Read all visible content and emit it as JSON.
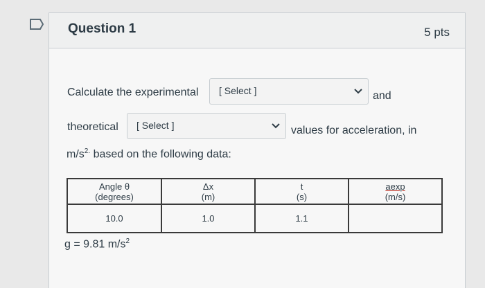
{
  "question": {
    "title": "Question 1",
    "points": "5 pts"
  },
  "prompt": {
    "line1_pre": "Calculate the experimental",
    "line1_post": "and",
    "line2_pre": "theoretical",
    "line2_post": "values for acceleration, in",
    "line3_unit": "m/s",
    "line3_sup": "2.",
    "line3_post": "based on the following data:"
  },
  "selects": {
    "experimental": {
      "value": "[ Select ]"
    },
    "theoretical": {
      "value": "[ Select ]"
    }
  },
  "table": {
    "headers": [
      {
        "line1": "Angle θ",
        "line2": "(degrees)"
      },
      {
        "line1": "Δx",
        "line2": "(m)"
      },
      {
        "line1": "t",
        "line2": "(s)"
      },
      {
        "line1": "aexp",
        "line2": "(m/s)"
      }
    ],
    "rows": [
      [
        "10.0",
        "1.0",
        "1.1",
        ""
      ]
    ]
  },
  "gravity": {
    "text": "g = 9.81 m/s",
    "sup": "2"
  },
  "colors": {
    "background": "#e9e9e9",
    "card": "#f7f7f7",
    "text": "#2d3b45"
  },
  "icons": {
    "flag": "bookmark-flag-icon",
    "chevron": "chevron-down-icon"
  }
}
